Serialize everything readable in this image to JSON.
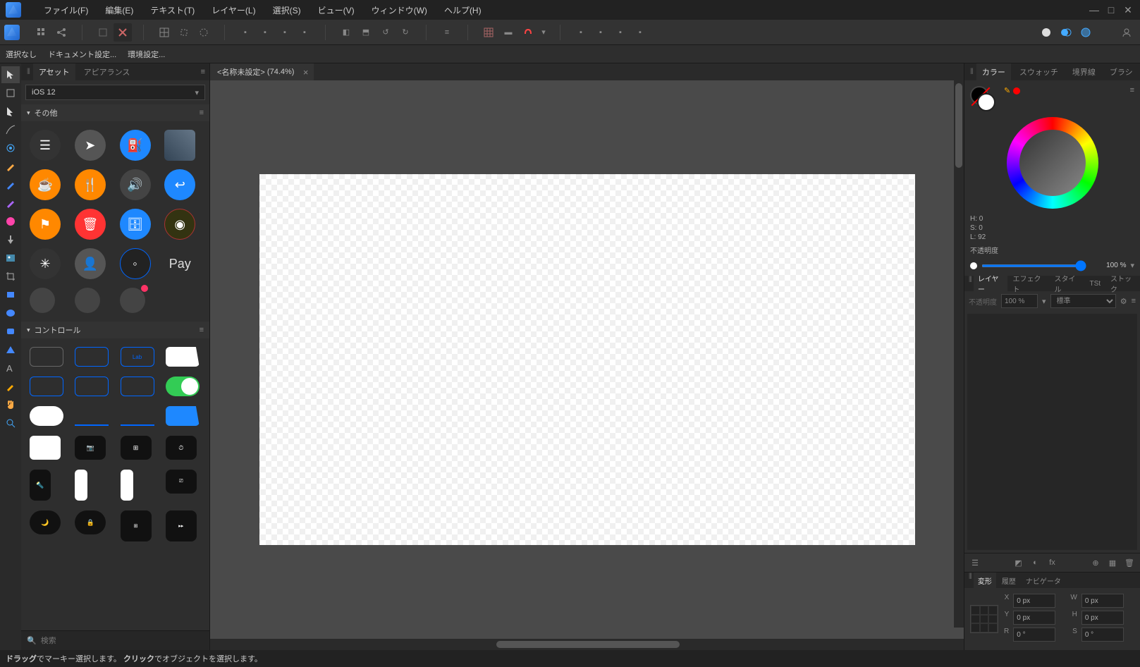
{
  "menubar": {
    "items": [
      "ファイル(F)",
      "編集(E)",
      "テキスト(T)",
      "レイヤー(L)",
      "選択(S)",
      "ビュー(V)",
      "ウィンドウ(W)",
      "ヘルプ(H)"
    ]
  },
  "contextbar": {
    "noSelection": "選択なし",
    "docSettings": "ドキュメント設定...",
    "envSettings": "環境設定..."
  },
  "leftPanel": {
    "tabs": [
      "アセット",
      "アピアランス"
    ],
    "preset": "iOS 12",
    "section1": "その他",
    "section2": "コントロール",
    "searchPlaceholder": "検索"
  },
  "document": {
    "tabTitle": "<名称未設定>",
    "zoom": "(74.4%)"
  },
  "rightPanel": {
    "colorTabs": [
      "カラー",
      "スウォッチ",
      "境界線",
      "ブラシ"
    ],
    "hsl": {
      "h": "H: 0",
      "s": "S: 0",
      "l": "L: 92"
    },
    "opacityLabel": "不透明度",
    "opacityValue": "100 %",
    "layerTabs": [
      "レイヤー",
      "エフェクト",
      "スタイル",
      "TSt",
      "ストック"
    ],
    "layerOpacity": "100 %",
    "blendMode": "標準",
    "transformTabs": [
      "変形",
      "履歴",
      "ナビゲータ"
    ],
    "xform": {
      "x": "0 px",
      "y": "0 px",
      "w": "0 px",
      "h": "0 px",
      "r": "0 °",
      "s": "0 °"
    }
  },
  "statusbar": {
    "drag": "ドラッグ",
    "dragText": "でマーキー選択します。",
    "click": "クリック",
    "clickText": "でオブジェクトを選択します。"
  }
}
